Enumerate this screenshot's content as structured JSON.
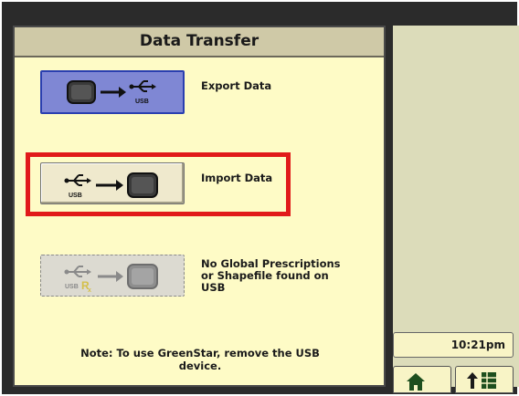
{
  "title": "Data Transfer",
  "export": {
    "label": "Export Data",
    "usb_text": "USB"
  },
  "import": {
    "label": "Import Data",
    "usb_text": "USB"
  },
  "no_global": {
    "line1": "No Global Prescriptions",
    "line2": "or Shapefile found on",
    "line3": "USB",
    "usb_text": "USB"
  },
  "note": {
    "line1": "Note: To use GreenStar, remove the USB",
    "line2": "device."
  },
  "clock": "10:21pm",
  "softkeys": {
    "home": "home-icon",
    "up": "up-arrow-menu-icon"
  },
  "colors": {
    "panel_bg": "#fefbc6",
    "title_bg": "#cfc9a7",
    "export_bg": "#7f87d4",
    "export_border": "#2a3fb0",
    "highlight": "#e11a1a",
    "right_area": "#dcdcba"
  }
}
